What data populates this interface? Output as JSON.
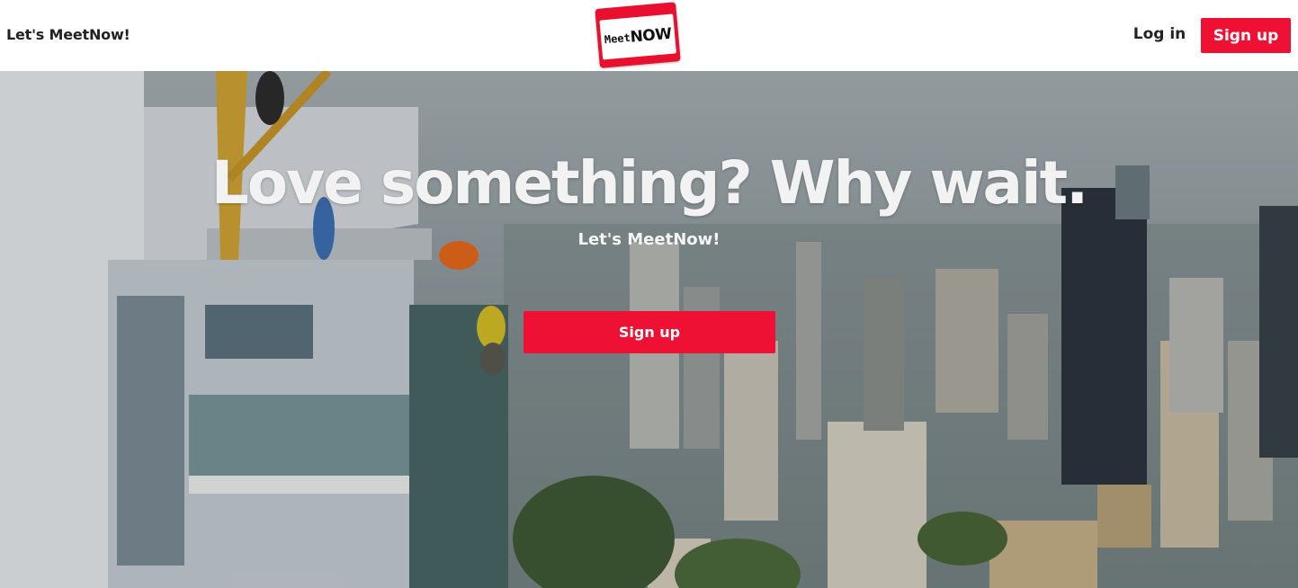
{
  "header": {
    "brand_text": "Let's MeetNow!",
    "logo": {
      "meet": "Meet",
      "now": "NOW"
    },
    "login_label": "Log in",
    "signup_label": "Sign up"
  },
  "hero": {
    "headline": "Love something? Why wait.",
    "subline": "Let's MeetNow!",
    "signup_label": "Sign up"
  },
  "colors": {
    "accent": "#ee1133",
    "header_bg": "#ffffff",
    "headline_text": "#f2f2f2"
  }
}
